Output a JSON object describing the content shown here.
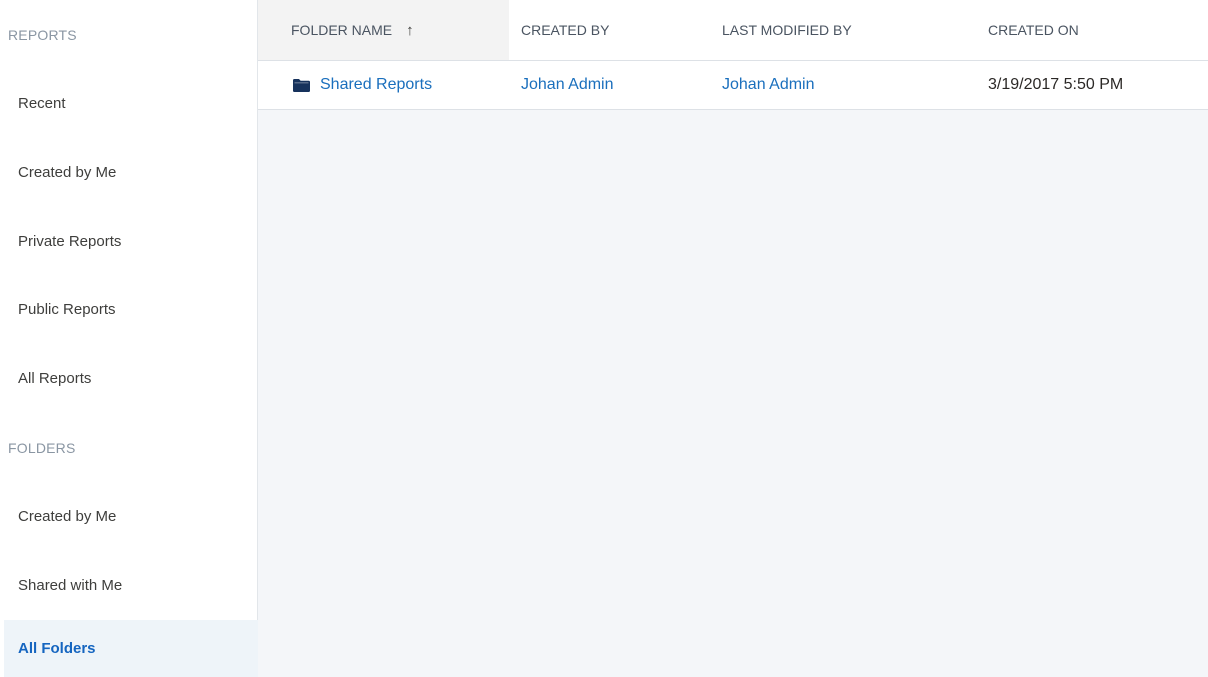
{
  "sidebar": {
    "reports_header": "REPORTS",
    "reports_items": [
      {
        "label": "Recent"
      },
      {
        "label": "Created by Me"
      },
      {
        "label": "Private Reports"
      },
      {
        "label": "Public Reports"
      },
      {
        "label": "All Reports"
      }
    ],
    "folders_header": "FOLDERS",
    "folders_items": [
      {
        "label": "Created by Me"
      },
      {
        "label": "Shared with Me"
      },
      {
        "label": "All Folders",
        "active": true
      }
    ]
  },
  "table": {
    "columns": [
      {
        "label": "FOLDER NAME",
        "sorted": true,
        "sort_direction": "ascending"
      },
      {
        "label": "CREATED BY"
      },
      {
        "label": "LAST MODIFIED BY"
      },
      {
        "label": "CREATED ON"
      }
    ],
    "sort_icon": "arrow-up-icon",
    "rows": [
      {
        "folder_icon": "folder-icon",
        "folder_name": "Shared Reports",
        "created_by": "Johan Admin",
        "last_modified_by": "Johan Admin",
        "created_on": "3/19/2017 5:50 PM"
      }
    ]
  },
  "colors": {
    "link": "#1a6fbd",
    "active_bg": "#eef4f9",
    "active_text": "#1565c0",
    "main_bg": "#f4f6f9",
    "folder_icon": "#16325c"
  }
}
